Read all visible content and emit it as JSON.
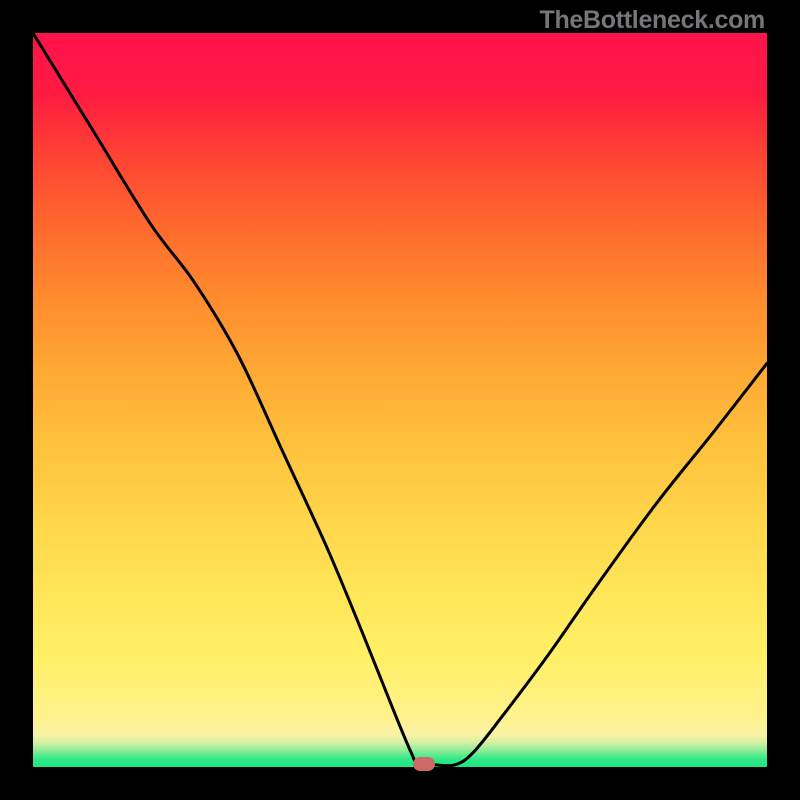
{
  "attribution": "TheBottleneck.com",
  "chart_data": {
    "type": "line",
    "title": "",
    "xlabel": "",
    "ylabel": "",
    "xlim": [
      0,
      1
    ],
    "ylim": [
      0,
      1
    ],
    "axes_visible": false,
    "background": "rainbow-gradient",
    "series": [
      {
        "name": "bottleneck-curve",
        "stroke": "#000000",
        "x": [
          0.0,
          0.08,
          0.16,
          0.22,
          0.28,
          0.34,
          0.4,
          0.45,
          0.49,
          0.515,
          0.525,
          0.545,
          0.575,
          0.6,
          0.64,
          0.7,
          0.77,
          0.85,
          0.93,
          1.0
        ],
        "y": [
          1.0,
          0.87,
          0.74,
          0.66,
          0.56,
          0.43,
          0.3,
          0.18,
          0.08,
          0.02,
          0.003,
          0.003,
          0.003,
          0.02,
          0.07,
          0.15,
          0.25,
          0.36,
          0.46,
          0.55
        ]
      }
    ],
    "marker": {
      "x": 0.533,
      "y": 0.004,
      "shape": "rounded-rect",
      "color": "#cc6a67"
    }
  },
  "colors": {
    "frame": "#000000",
    "gradient_top": "#ff134c",
    "gradient_mid": "#ffe558",
    "gradient_bottom": "#19e880",
    "marker": "#cc6a67",
    "attribution_text": "#76767a"
  }
}
